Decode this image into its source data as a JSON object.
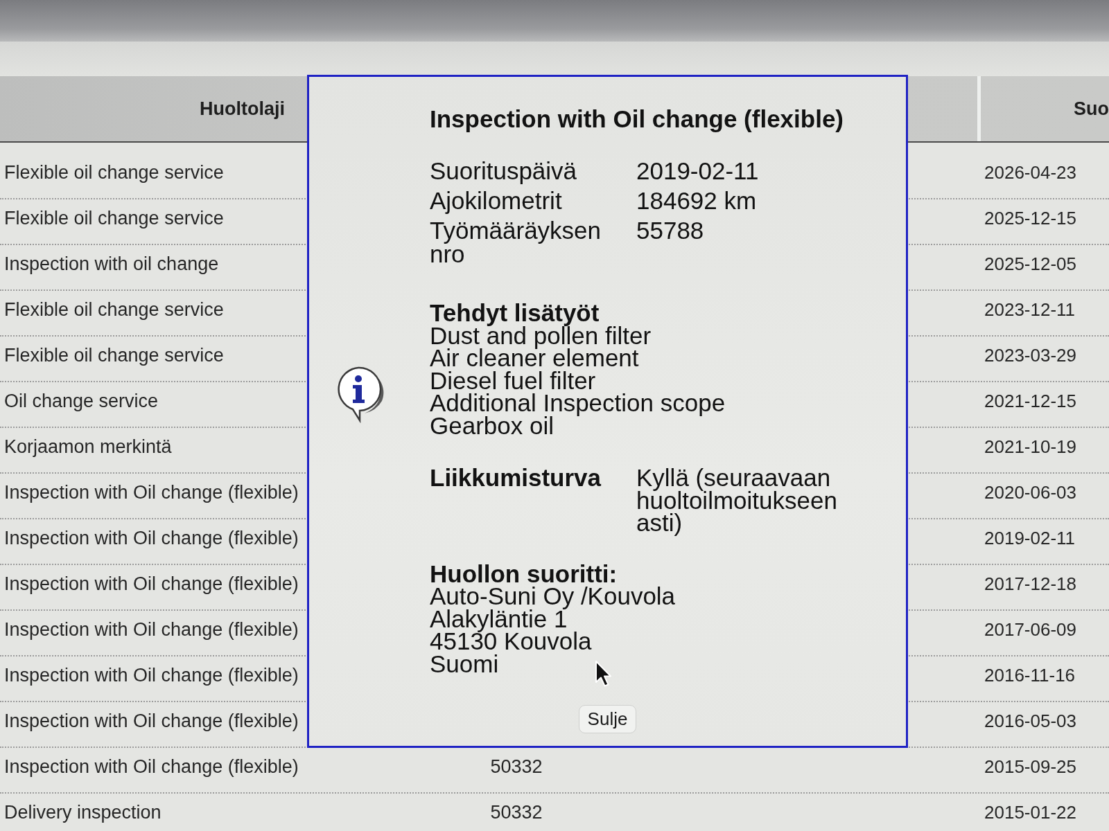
{
  "table": {
    "columns": {
      "service_type": "Huoltolaji",
      "column_4": "Suo"
    },
    "rows": [
      {
        "service_type": "Flexible oil change service",
        "date": "2026-04-23"
      },
      {
        "service_type": "Flexible oil change service",
        "date": "2025-12-15"
      },
      {
        "service_type": "Inspection with oil change",
        "date": "2025-12-05"
      },
      {
        "service_type": "Flexible oil change service",
        "date": "2023-12-11"
      },
      {
        "service_type": "Flexible oil change service",
        "date": "2023-03-29"
      },
      {
        "service_type": "Oil change service",
        "date": "2021-12-15"
      },
      {
        "service_type": "Korjaamon merkintä",
        "date": "2021-10-19"
      },
      {
        "service_type": "Inspection with Oil change (flexible)",
        "date": "2020-06-03"
      },
      {
        "service_type": "Inspection with Oil change (flexible)",
        "date": "2019-02-11"
      },
      {
        "service_type": "Inspection with Oil change (flexible)",
        "date": "2017-12-18"
      },
      {
        "service_type": "Inspection with Oil change (flexible)",
        "date": "2017-06-09"
      },
      {
        "service_type": "Inspection with Oil change (flexible)",
        "date": "2016-11-16"
      },
      {
        "service_type": "Inspection with Oil change (flexible)",
        "date": "2016-05-03"
      },
      {
        "service_type": "Inspection with Oil change (flexible)",
        "column_2": "50332",
        "date": "2015-09-25"
      },
      {
        "service_type": "Delivery inspection",
        "column_2": "50332",
        "date": "2015-01-22"
      }
    ]
  },
  "dialog": {
    "title": "Inspection with Oil change (flexible)",
    "fields": [
      {
        "label": "Suorituspäivä",
        "value": "2019-02-11"
      },
      {
        "label": "Ajokilometrit",
        "value": "184692 km"
      },
      {
        "label": "Työmääräyksen nro",
        "value": "55788"
      }
    ],
    "extra_work": {
      "heading": "Tehdyt lisätyöt",
      "items": [
        "Dust and pollen filter",
        "Air cleaner element",
        "Diesel fuel filter",
        "Additional Inspection scope",
        "Gearbox oil"
      ]
    },
    "mobility": {
      "label": "Liikkumisturva",
      "value": "Kyllä (seuraavaan huoltoilmoitukseen asti)"
    },
    "performed_by": {
      "heading": "Huollon suoritti:",
      "lines": [
        "Auto-Suni Oy /Kouvola",
        "Alakyläntie 1",
        "45130 Kouvola",
        "Suomi"
      ]
    },
    "close_button": "Sulje"
  }
}
